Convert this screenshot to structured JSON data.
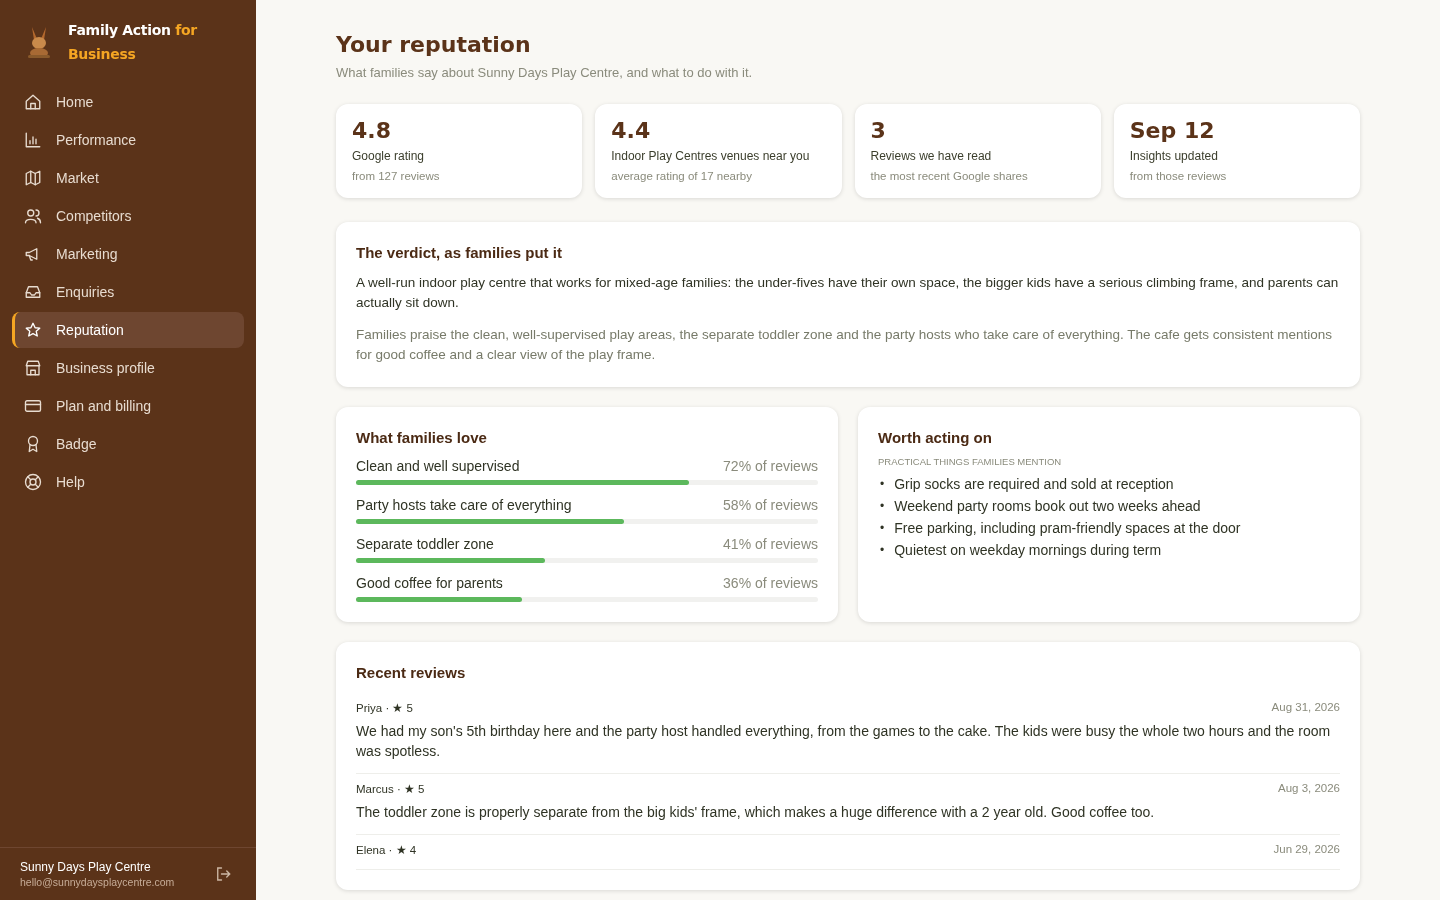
{
  "brand": {
    "name": "Family Action",
    "accent": "for Business"
  },
  "nav": [
    {
      "label": "Home",
      "selected": false
    },
    {
      "label": "Performance",
      "selected": false
    },
    {
      "label": "Market",
      "selected": false
    },
    {
      "label": "Competitors",
      "selected": false
    },
    {
      "label": "Marketing",
      "selected": false
    },
    {
      "label": "Enquiries",
      "selected": false
    },
    {
      "label": "Reputation",
      "selected": true
    },
    {
      "label": "Business profile",
      "selected": false
    },
    {
      "label": "Plan and billing",
      "selected": false
    },
    {
      "label": "Badge",
      "selected": false
    },
    {
      "label": "Help",
      "selected": false
    }
  ],
  "account": {
    "name": "Sunny Days Play Centre",
    "email": "hello@sunnydaysplaycentre.com"
  },
  "page": {
    "title": "Your reputation",
    "subtitle": "What families say about Sunny Days Play Centre, and what to do with it."
  },
  "stats": [
    {
      "value": "4.8",
      "label": "Google rating",
      "note": "from 127 reviews"
    },
    {
      "value": "4.4",
      "label": "Indoor Play Centres venues near you",
      "note": "average rating of 17 nearby"
    },
    {
      "value": "3",
      "label": "Reviews we have read",
      "note": "the most recent Google shares"
    },
    {
      "value": "Sep 12",
      "label": "Insights updated",
      "note": "from those reviews"
    }
  ],
  "verdict": {
    "title": "The verdict, as families put it",
    "summary": "A well-run indoor play centre that works for mixed-age families: the under-fives have their own space, the bigger kids have a serious climbing frame, and parents can actually sit down.",
    "detail": "Families praise the clean, well-supervised play areas, the separate toddler zone and the party hosts who take care of everything. The cafe gets consistent mentions for good coffee and a clear view of the play frame."
  },
  "love": {
    "title": "What families love",
    "items": [
      {
        "label": "Clean and well supervised",
        "reading": "72% of reviews",
        "level": 0.72
      },
      {
        "label": "Party hosts take care of everything",
        "reading": "58% of reviews",
        "level": 0.58
      },
      {
        "label": "Separate toddler zone",
        "reading": "41% of reviews",
        "level": 0.41
      },
      {
        "label": "Good coffee for parents",
        "reading": "36% of reviews",
        "level": 0.36
      }
    ]
  },
  "acting": {
    "title": "Worth acting on",
    "subheading": "PRACTICAL THINGS FAMILIES MENTION",
    "items": [
      {
        "bullet": "•",
        "text": "Grip socks are required and sold at reception"
      },
      {
        "bullet": "•",
        "text": "Weekend party rooms book out two weeks ahead"
      },
      {
        "bullet": "•",
        "text": "Free parking, including pram-friendly spaces at the door"
      },
      {
        "bullet": "•",
        "text": "Quietest on weekday mornings during term"
      }
    ]
  },
  "reviews": {
    "title": "Recent reviews",
    "items": [
      {
        "author": "Priya · ★ 5",
        "date": "Aug 31, 2026",
        "text": "We had my son's 5th birthday here and the party host handled everything, from the games to the cake. The kids were busy the whole two hours and the room was spotless."
      },
      {
        "author": "Marcus · ★ 5",
        "date": "Aug 3, 2026",
        "text": "The toddler zone is properly separate from the big kids' frame, which makes a huge difference with a 2 year old. Good coffee too."
      },
      {
        "author": "Elena · ★ 4",
        "date": "Jun 29, 2026"
      }
    ]
  }
}
